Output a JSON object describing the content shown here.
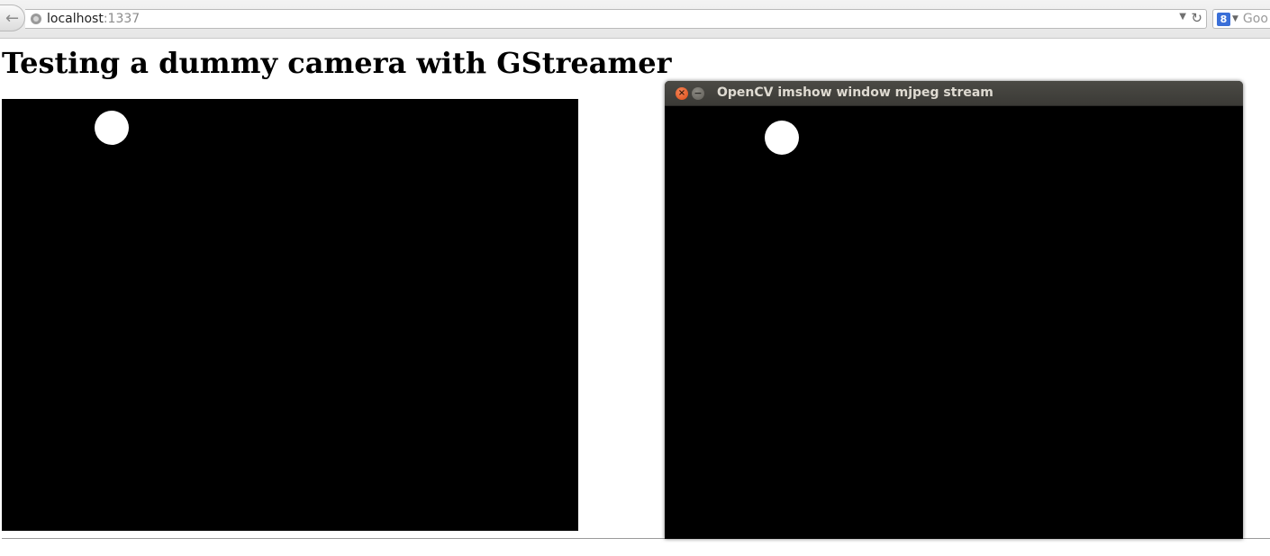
{
  "browser": {
    "url_host": "localhost",
    "url_port": ":1337",
    "search_placeholder": "Goo",
    "search_engine_glyph": "8"
  },
  "icons": {
    "back": "back-arrow-icon",
    "site": "site-identity-icon",
    "dropdown": "dropdown-arrow-icon",
    "reload": "reload-icon",
    "search_engine": "google-icon",
    "close": "close-icon",
    "minimize": "minimize-icon"
  },
  "page": {
    "heading": "Testing a dummy camera with GStreamer"
  },
  "cv_window": {
    "title": "OpenCV imshow window mjpeg stream"
  },
  "colors": {
    "stream_background": "#000000",
    "dot": "#ffffff",
    "close_button": "#dd4b14",
    "titlebar": "#3f3e3a"
  }
}
